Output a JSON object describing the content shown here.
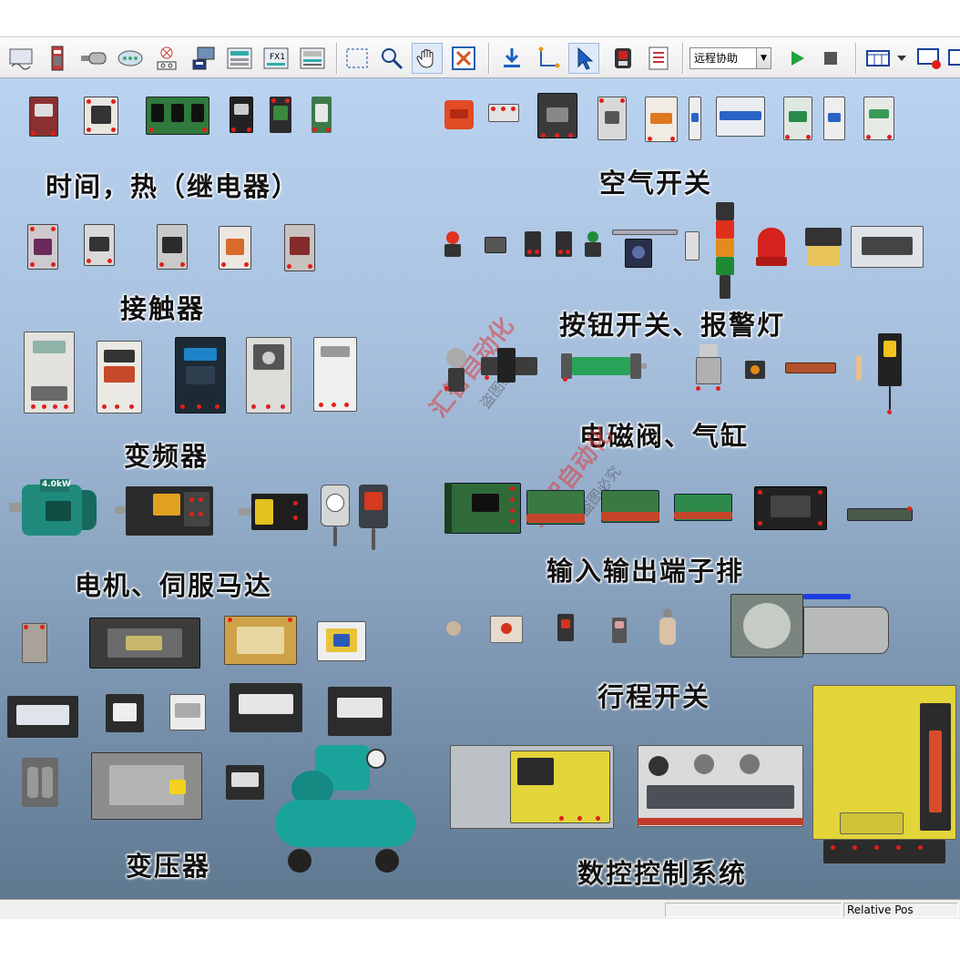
{
  "toolbar": {
    "remote_assist_value": "远程协助",
    "icons": [
      "component-library-icon",
      "relay-icon",
      "sensor-icon",
      "led-bar-icon",
      "lamp-icon",
      "computer-icon",
      "panel-icon",
      "fx-plc-icon",
      "io-module-icon",
      "select-rect-icon",
      "zoom-icon",
      "pan-hand-icon",
      "fit-view-icon",
      "download-icon",
      "wire-icon",
      "pointer-icon",
      "power-switch-icon",
      "list-icon",
      "run-icon",
      "stop-icon",
      "layout-icon",
      "dropdown-icon",
      "record-icon",
      "grid-icon"
    ]
  },
  "labels": {
    "relay": "时间，热（继电器）",
    "air_switch": "空气开关",
    "contactor": "接触器",
    "button_alarm": "按钮开关、报警灯",
    "vfd": "变频器",
    "solenoid_cylinder": "电磁阀、气缸",
    "motor_servo": "电机、伺服马达",
    "terminal_block": "输入输出端子排",
    "limit_switch": "行程开关",
    "transformer": "变压器",
    "cnc_system": "数控控制系统"
  },
  "watermarks": {
    "brand": "汇智自动化",
    "sub": "盗图必究"
  },
  "devices": {
    "motor_rating": "4.0kW"
  },
  "statusbar": {
    "relative_pos": "Relative Pos"
  },
  "colors": {
    "terminal_red": "#e0201c",
    "fanuc_yellow": "#e3d43a",
    "compressor_teal": "#1aa39a",
    "motor_teal": "#1f8a7c"
  }
}
